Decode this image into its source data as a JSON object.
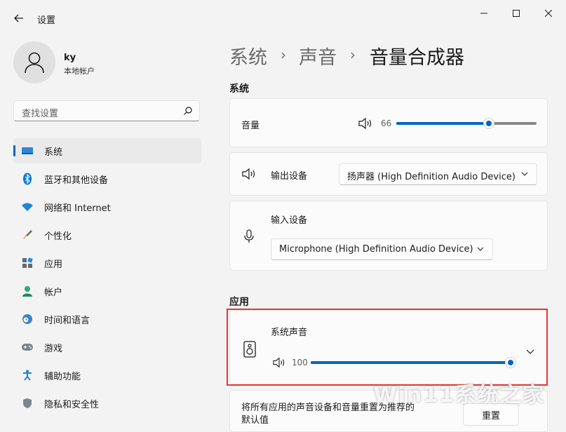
{
  "window": {
    "title": "设置",
    "controls": [
      "minimize-icon",
      "maximize-icon",
      "close-icon"
    ]
  },
  "user": {
    "name": "ky",
    "account_type": "本地帐户"
  },
  "search": {
    "placeholder": "查找设置"
  },
  "sidebar": {
    "items": [
      {
        "label": "系统",
        "icon": "system-icon",
        "active": true
      },
      {
        "label": "蓝牙和其他设备",
        "icon": "bluetooth-icon"
      },
      {
        "label": "网络和 Internet",
        "icon": "wifi-icon"
      },
      {
        "label": "个性化",
        "icon": "brush-icon"
      },
      {
        "label": "应用",
        "icon": "apps-icon"
      },
      {
        "label": "帐户",
        "icon": "account-icon"
      },
      {
        "label": "时间和语言",
        "icon": "clock-globe-icon"
      },
      {
        "label": "游戏",
        "icon": "gamepad-icon"
      },
      {
        "label": "辅助功能",
        "icon": "accessibility-icon"
      },
      {
        "label": "隐私和安全性",
        "icon": "shield-icon"
      }
    ]
  },
  "breadcrumb": {
    "part1": "系统",
    "part2": "声音",
    "current": "音量合成器",
    "separator": "›"
  },
  "system_section": {
    "title": "系统",
    "volume": {
      "label": "音量",
      "value": "66",
      "level": 0.66
    },
    "output": {
      "label": "输出设备",
      "selected": "扬声器 (High Definition Audio Device)"
    },
    "input": {
      "label": "输入设备",
      "selected": "Microphone (High Definition Audio Device)"
    }
  },
  "apps_section": {
    "title": "应用",
    "system_sounds": {
      "label": "系统声音",
      "value": "100",
      "level": 1.0
    }
  },
  "reset": {
    "text_line1": "将所有应用的声音设备和音量重置为推荐的",
    "text_line2": "默认值",
    "button": "重置"
  },
  "watermark": {
    "text": "Win11系统之家"
  },
  "colors": {
    "accent": "#0067c0",
    "highlight": "#e53935",
    "background": "#f3f3f3",
    "card": "#fbfbfb"
  }
}
